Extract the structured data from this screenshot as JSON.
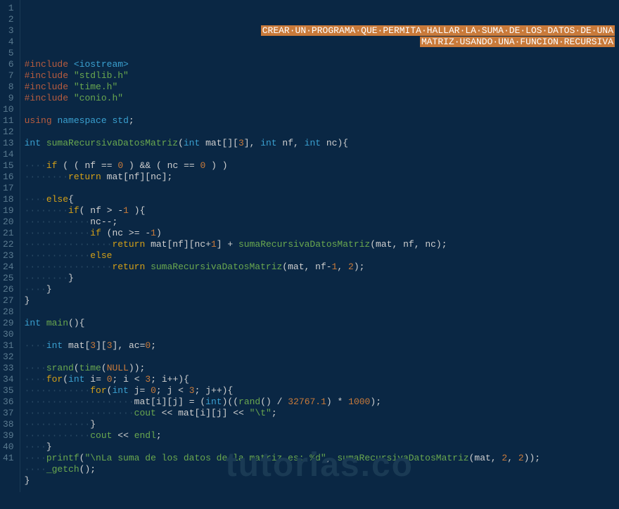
{
  "watermark": "tutorias.co",
  "gutter_start": 1,
  "gutter_end": 41,
  "header_comment_line1": "CREAR·UN·PROGRAMA·QUE·PERMITA·HALLAR·LA·SUMA·DE·LOS·DATOS·DE·UNA",
  "header_comment_line2": "MATRIZ·USANDO·UNA·FUNCION·RECURSIVA",
  "code_lines": [
    {
      "n": 1,
      "raw": true
    },
    {
      "n": 2,
      "raw": true
    },
    {
      "n": 3,
      "t": ""
    },
    {
      "n": 4,
      "t": "#include <iostream>"
    },
    {
      "n": 5,
      "t": "#include \"stdlib.h\""
    },
    {
      "n": 6,
      "t": "#include \"time.h\""
    },
    {
      "n": 7,
      "t": "#include \"conio.h\""
    },
    {
      "n": 8,
      "t": ""
    },
    {
      "n": 9,
      "t": "using namespace std;"
    },
    {
      "n": 10,
      "t": ""
    },
    {
      "n": 11,
      "t": "int sumaRecursivaDatosMatriz(int mat[][3], int nf, int nc){"
    },
    {
      "n": 12,
      "t": ""
    },
    {
      "n": 13,
      "t": "    if ( ( nf == 0 ) && ( nc == 0 ) )"
    },
    {
      "n": 14,
      "t": "        return mat[nf][nc];"
    },
    {
      "n": 15,
      "t": ""
    },
    {
      "n": 16,
      "t": "    else{"
    },
    {
      "n": 17,
      "t": "        if( nf > -1 ){"
    },
    {
      "n": 18,
      "t": "            nc--;"
    },
    {
      "n": 19,
      "t": "            if (nc >= -1)"
    },
    {
      "n": 20,
      "t": "                return mat[nf][nc+1] + sumaRecursivaDatosMatriz(mat, nf, nc);"
    },
    {
      "n": 21,
      "t": "            else"
    },
    {
      "n": 22,
      "t": "                return sumaRecursivaDatosMatriz(mat, nf-1, 2);"
    },
    {
      "n": 23,
      "t": "        }"
    },
    {
      "n": 24,
      "t": "    }"
    },
    {
      "n": 25,
      "t": "}"
    },
    {
      "n": 26,
      "t": ""
    },
    {
      "n": 27,
      "t": "int main(){"
    },
    {
      "n": 28,
      "t": ""
    },
    {
      "n": 29,
      "t": "    int mat[3][3], ac=0;"
    },
    {
      "n": 30,
      "t": ""
    },
    {
      "n": 31,
      "t": "    srand(time(NULL));"
    },
    {
      "n": 32,
      "t": "    for(int i= 0; i < 3; i++){"
    },
    {
      "n": 33,
      "t": "            for(int j= 0; j < 3; j++){"
    },
    {
      "n": 34,
      "t": "                    mat[i][j] = (int)((rand() / 32767.1) * 1000);"
    },
    {
      "n": 35,
      "t": "                    cout << mat[i][j] << \"\\t\";"
    },
    {
      "n": 36,
      "t": "            }"
    },
    {
      "n": 37,
      "t": "            cout << endl;"
    },
    {
      "n": 38,
      "t": "    }"
    },
    {
      "n": 39,
      "t": "    printf(\"\\nLa suma de los datos de la matriz es: %d\", sumaRecursivaDatosMatriz(mat, 2, 2));"
    },
    {
      "n": 40,
      "t": "    _getch();"
    },
    {
      "n": 41,
      "t": "}"
    }
  ]
}
